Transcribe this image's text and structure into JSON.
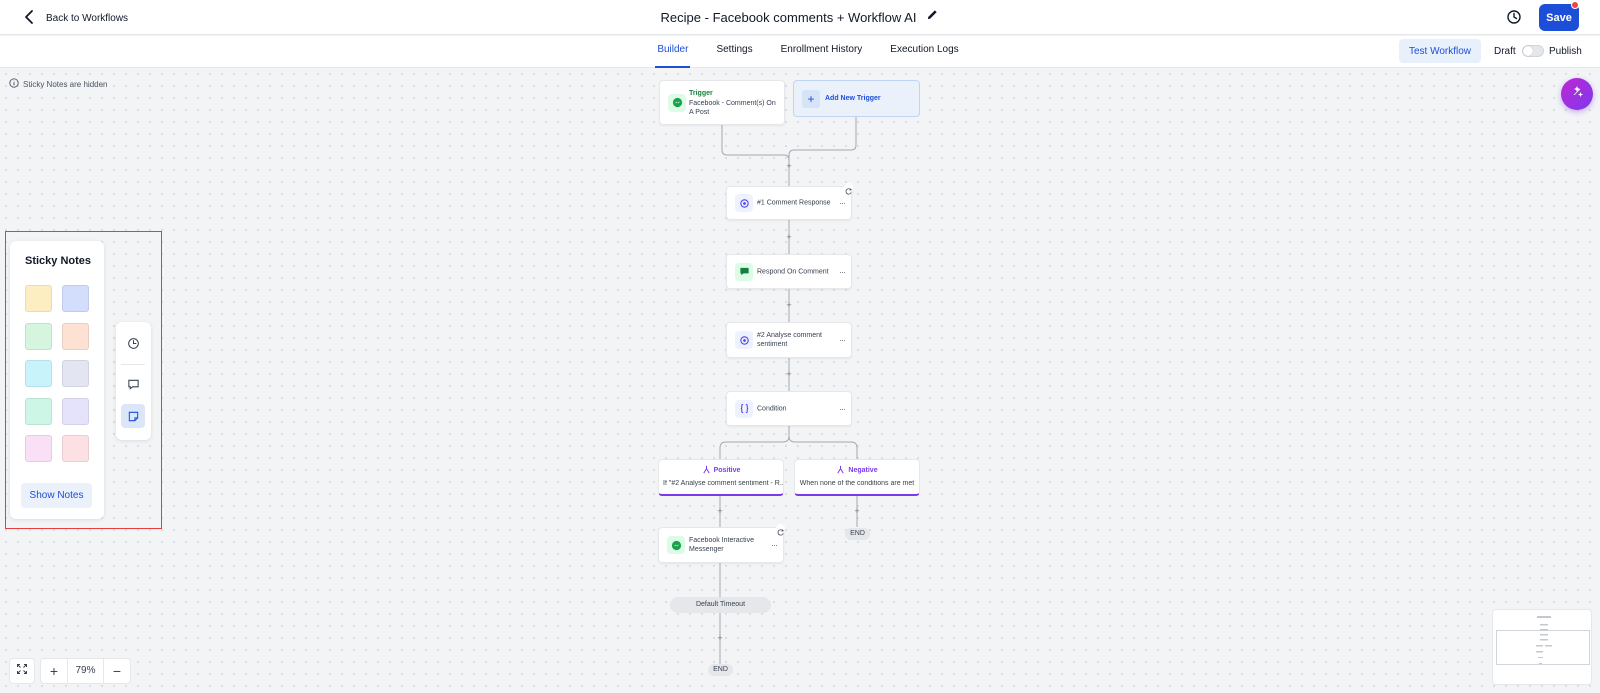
{
  "header": {
    "back_label": "Back to Workflows",
    "title": "Recipe - Facebook comments + Workflow AI",
    "save_label": "Save"
  },
  "tabs": [
    {
      "label": "Builder",
      "active": true
    },
    {
      "label": "Settings",
      "active": false
    },
    {
      "label": "Enrollment History",
      "active": false
    },
    {
      "label": "Execution Logs",
      "active": false
    }
  ],
  "toolbar": {
    "test_label": "Test Workflow",
    "draft_label": "Draft",
    "publish_label": "Publish",
    "published": false
  },
  "canvas": {
    "hidden_notice": "Sticky Notes are hidden",
    "trigger": {
      "kicker": "Trigger",
      "description": "Facebook - Comment(s) On A Post"
    },
    "add_trigger_label": "Add New Trigger",
    "actions": [
      {
        "label": "#1 Comment Response",
        "icon": "ai-gear-icon"
      },
      {
        "label": "Respond On Comment",
        "icon": "chat-bubble-icon"
      },
      {
        "label": "#2 Analyse comment sentiment",
        "icon": "ai-gear-icon"
      },
      {
        "label": "Condition",
        "icon": "curly-braces-icon"
      }
    ],
    "branches": [
      {
        "title": "Positive",
        "description": "If \"#2 Analyse comment sentiment - R..."
      },
      {
        "title": "Negative",
        "description": "When none of the conditions are met"
      }
    ],
    "messenger_action": {
      "label": "Facebook Interactive Messenger"
    },
    "timeout_label": "Default Timeout",
    "end_label": "END",
    "plus_label": "+",
    "more_label": "···"
  },
  "sticky_panel": {
    "title": "Sticky Notes",
    "swatch_colors": [
      "#fdeec2",
      "#d2defb",
      "#d6f5de",
      "#fde1d2",
      "#c9f3fb",
      "#e3e6f2",
      "#cdf6e6",
      "#e5e2fb",
      "#fae0f6",
      "#fde0e4"
    ],
    "show_notes_label": "Show Notes"
  },
  "zoom": {
    "plus": "+",
    "value": "79%",
    "minus": "−"
  },
  "colors": {
    "accent": "#1d4ed8",
    "branch": "#7c3aed",
    "highlight": "#e53e3e"
  }
}
